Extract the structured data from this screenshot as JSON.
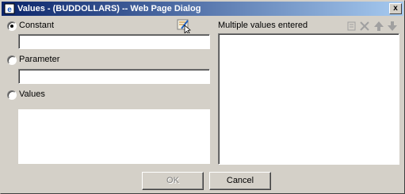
{
  "window": {
    "title": "Values - (BUDDOLLARS) -- Web Page Dialog",
    "close_label": "x"
  },
  "left": {
    "constant_label": "Constant",
    "parameter_label": "Parameter",
    "values_label": "Values",
    "selected": "Constant",
    "constant_value": "",
    "parameter_value": ""
  },
  "right": {
    "header": "Multiple values entered"
  },
  "icons": [
    "value-picker-icon",
    "add-icon",
    "delete-icon",
    "move-up-icon",
    "move-down-icon"
  ],
  "buttons": {
    "ok": "OK",
    "cancel": "Cancel"
  }
}
